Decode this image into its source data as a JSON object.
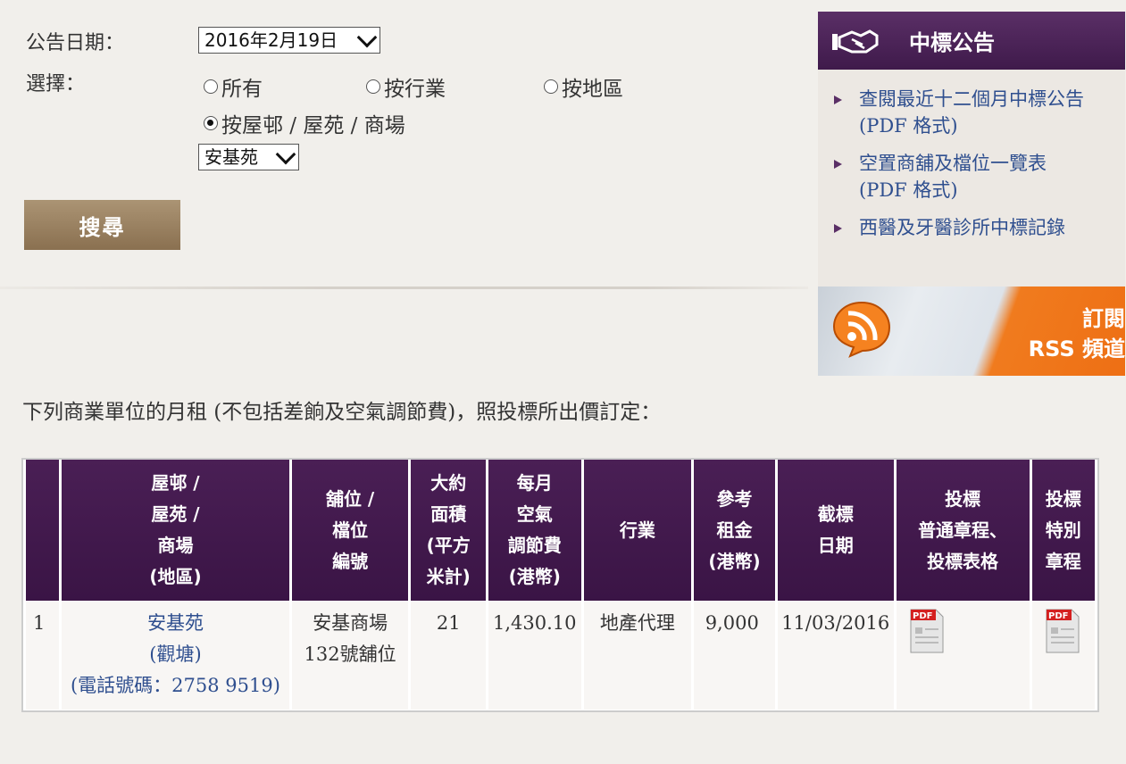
{
  "form": {
    "date_label": "公告日期：",
    "date_value": "2016年2月19日",
    "choice_label": "選擇：",
    "radios": [
      {
        "label": "所有",
        "checked": false
      },
      {
        "label": "按行業",
        "checked": false
      },
      {
        "label": "按地區",
        "checked": false
      },
      {
        "label": "按屋邨 / 屋苑 / 商場",
        "checked": true
      }
    ],
    "estate_value": "安基苑",
    "search_label": "搜尋"
  },
  "side": {
    "title": "中標公告",
    "links": [
      {
        "line1": "查閱最近十二個月中標公告",
        "line2": "(PDF 格式)"
      },
      {
        "line1": "空置商舖及檔位一覽表",
        "line2": "(PDF 格式)"
      },
      {
        "line1": "西醫及牙醫診所中標記錄",
        "line2": ""
      }
    ],
    "rss_line1": "訂閱",
    "rss_line2": "RSS 頻道"
  },
  "intro": "下列商業單位的月租 (不包括差餉及空氣調節費)，照投標所出價訂定：",
  "table": {
    "headers": [
      "",
      "屋邨 /\n屋苑 /\n商場\n(地區)",
      "舖位 /\n檔位\n編號",
      "大約\n面積\n(平方\n米計)",
      "每月\n空氣\n調節費\n(港幣)",
      "行業",
      "參考\n租金\n(港幣)",
      "截標\n日期",
      "投標\n普通章程、\n投標表格",
      "投標\n特別\n章程"
    ],
    "rows": [
      {
        "index": "1",
        "estate_name": "安基苑",
        "estate_district": "(觀塘)",
        "estate_phone": "(電話號碼：2758 9519)",
        "unit_line1": "安基商場",
        "unit_line2": "132號舖位",
        "area": "21",
        "ac_fee": "1,430.10",
        "trade": "地產代理",
        "rent": "9,000",
        "closing": "11/03/2016",
        "pdf_label": "PDF"
      }
    ]
  },
  "colors": {
    "accent": "#4a1f55",
    "link": "#2f4f8f",
    "button": "#9a8262",
    "rss": "#ee6f14"
  },
  "icons": {
    "side_header": "handshake-icon",
    "bullet": "triangle-bullet-icon",
    "rss": "rss-icon",
    "pdf": "pdf-file-icon"
  }
}
